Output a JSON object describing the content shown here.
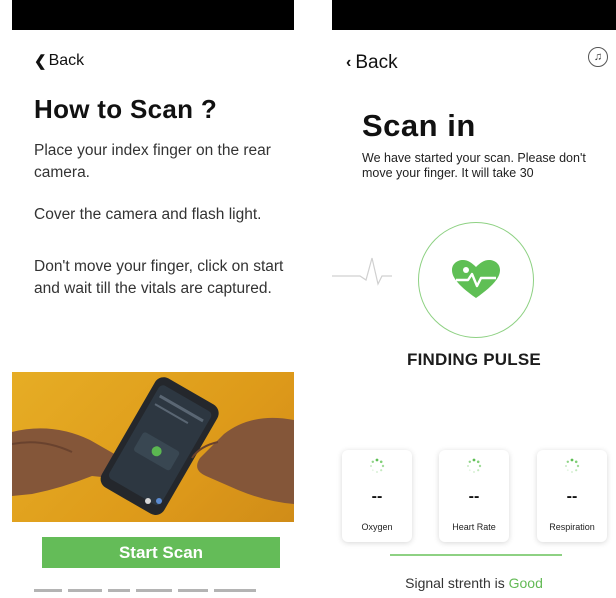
{
  "left_screen": {
    "back_label": "Back",
    "title": "How to Scan ?",
    "instructions": [
      "Place your index finger on the rear camera.",
      "Cover the camera and flash light.",
      "Don't move your finger, click on start and wait till the vitals are captured."
    ],
    "carousel": {
      "slides": 2,
      "active_index": 1
    },
    "start_button_label": "Start Scan"
  },
  "right_screen": {
    "back_label": "Back",
    "title": "Scan in",
    "description_line1": "We have started your scan. Please don't",
    "description_line2": "move your finger. It will take 30",
    "status_label": "FINDING PULSE",
    "vitals": [
      {
        "value": "--",
        "label": "Oxygen"
      },
      {
        "value": "--",
        "label": "Heart Rate"
      },
      {
        "value": "--",
        "label": "Respiration"
      }
    ],
    "signal_prefix": "Signal strenth is",
    "signal_quality": "Good"
  },
  "colors": {
    "accent_green": "#64bc58",
    "circle_green": "#8ed183",
    "heart_green": "#5fbf55",
    "photo_yellow": "#f0b427",
    "carousel_active": "#5b8bd1"
  },
  "icons": {
    "back": "chevron-left-icon",
    "music": "music-note-icon",
    "pulse": "heart-pulse-icon",
    "loading": "loading-spinner-icon"
  }
}
